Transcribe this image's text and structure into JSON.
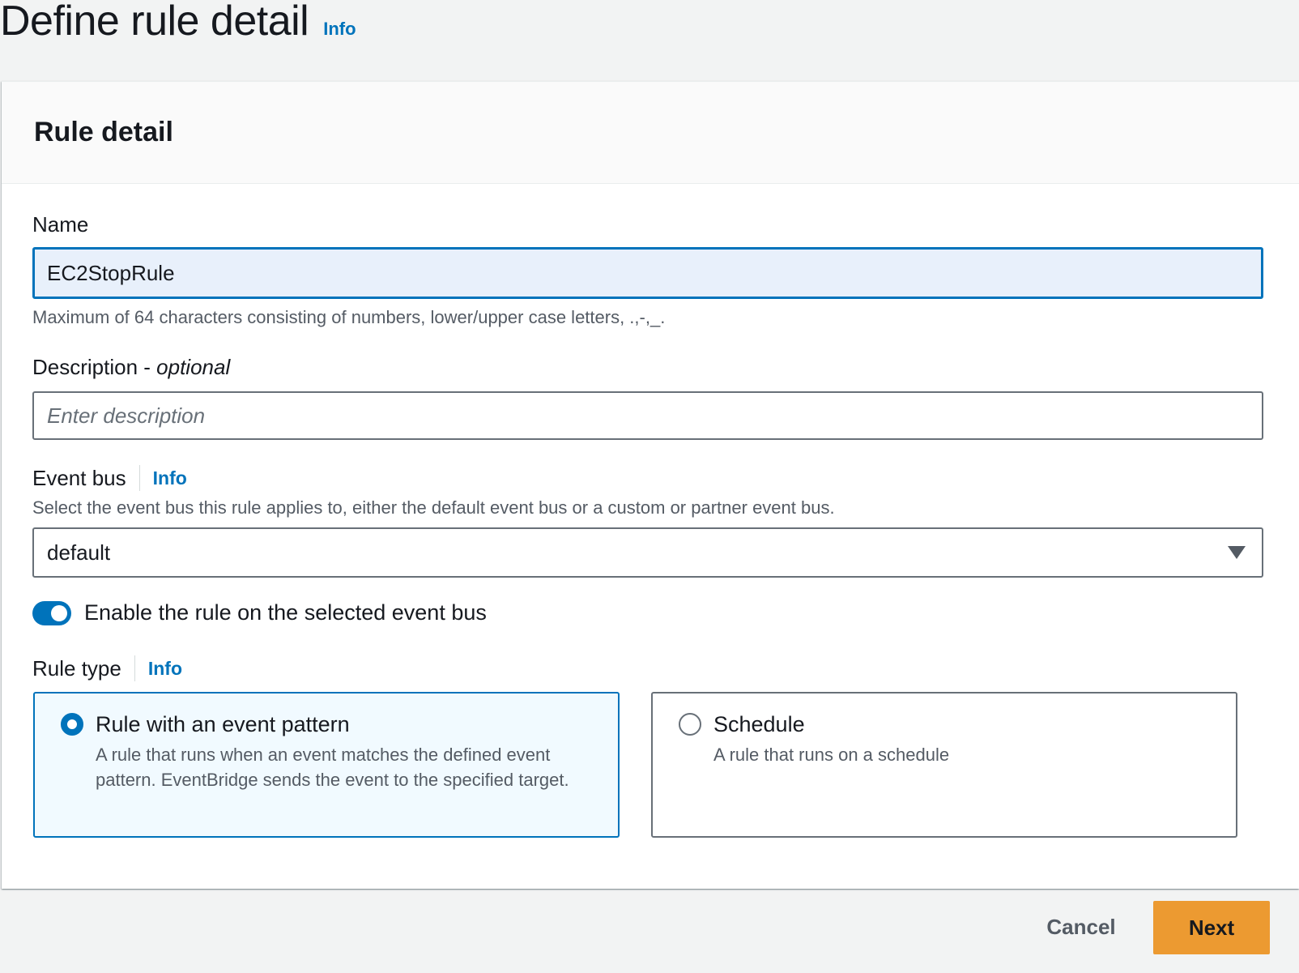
{
  "page": {
    "title": "Define rule detail",
    "info_label": "Info"
  },
  "panel": {
    "title": "Rule detail"
  },
  "name_field": {
    "label": "Name",
    "value": "EC2StopRule",
    "hint": "Maximum of 64 characters consisting of numbers, lower/upper case letters, .,-,_."
  },
  "description_field": {
    "label": "Description - ",
    "optional_label": "optional",
    "placeholder": "Enter description",
    "value": ""
  },
  "event_bus": {
    "label": "Event bus",
    "info_label": "Info",
    "hint": "Select the event bus this rule applies to, either the default event bus or a custom or partner event bus.",
    "selected": "default"
  },
  "enable_toggle": {
    "label": "Enable the rule on the selected event bus",
    "enabled": true
  },
  "rule_type": {
    "label": "Rule type",
    "info_label": "Info",
    "options": [
      {
        "title": "Rule with an event pattern",
        "description": "A rule that runs when an event matches the defined event pattern. EventBridge sends the event to the specified target.",
        "selected": true
      },
      {
        "title": "Schedule",
        "description": "A rule that runs on a schedule",
        "selected": false
      }
    ]
  },
  "footer": {
    "cancel_label": "Cancel",
    "next_label": "Next"
  },
  "colors": {
    "accent": "#0073bb",
    "primary_button": "#ec9a31",
    "background": "#f2f3f3"
  }
}
